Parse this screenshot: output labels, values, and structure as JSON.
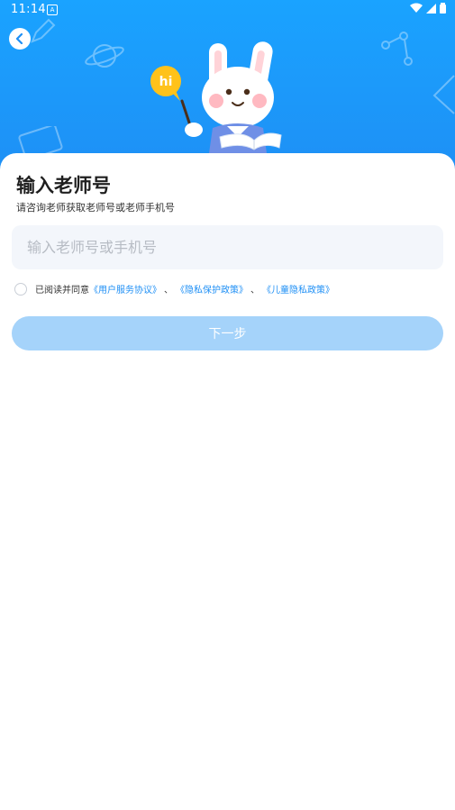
{
  "status_bar": {
    "time": "11:14",
    "notification_glyph": "A",
    "icons": [
      "wifi-icon",
      "signal-icon",
      "battery-icon"
    ]
  },
  "hero": {
    "bubble_text": "hi",
    "background_color": "#1e98fa"
  },
  "form": {
    "title": "输入老师号",
    "subtitle": "请咨询老师获取老师号或老师手机号",
    "input_placeholder": "输入老师号或手机号",
    "input_value": "",
    "agreement_prefix": "已阅读并同意",
    "link_user_agreement": "《用户服务协议》",
    "separator_1": "、",
    "link_privacy": "《隐私保护政策》",
    "separator_2": "、",
    "link_child_privacy": "《儿童隐私政策》",
    "agree_checked": false,
    "next_label": "下一步"
  },
  "colors": {
    "accent": "#1e8ff5",
    "button_disabled": "#a5d3fa",
    "input_bg": "#f3f6fb"
  }
}
